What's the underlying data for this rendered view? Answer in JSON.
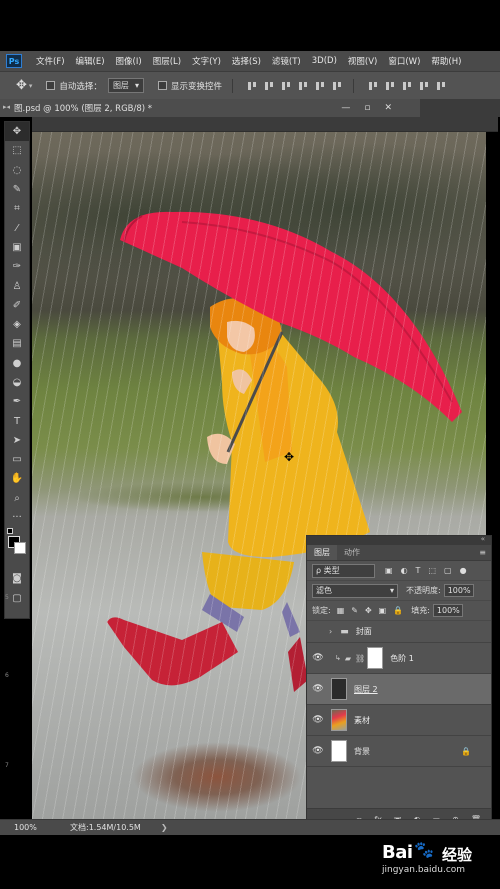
{
  "app": {
    "logo_text": "Ps"
  },
  "menu": [
    "文件(F)",
    "编辑(E)",
    "图像(I)",
    "图层(L)",
    "文字(Y)",
    "选择(S)",
    "滤镜(T)",
    "3D(D)",
    "视图(V)",
    "窗口(W)",
    "帮助(H)"
  ],
  "options_bar": {
    "auto_select_label": "自动选择：",
    "auto_select_value": "图层",
    "show_transform_label": "显示变换控件"
  },
  "document_tab": {
    "title": "图.psd @ 100% (图层 2, RGB/8) *"
  },
  "status_bar": {
    "zoom": "100%",
    "doc_info": "文档:1.54M/10.5M",
    "arrow": "❯"
  },
  "ruler_marks": [
    "5",
    "6",
    "7"
  ],
  "layers_panel": {
    "tabs": [
      "图层",
      "动作"
    ],
    "filter_label": "ρ 类型",
    "blend_mode": "滤色",
    "opacity_label": "不透明度:",
    "opacity_value": "100%",
    "lock_label": "锁定:",
    "fill_label": "填充:",
    "fill_value": "100%",
    "layers": [
      {
        "name": "封面",
        "type": "group",
        "visible": false
      },
      {
        "name": "色阶 1",
        "type": "adjustment",
        "visible": true
      },
      {
        "name": "图层 2",
        "type": "pixel",
        "visible": true,
        "selected": true
      },
      {
        "name": "素材",
        "type": "photo",
        "visible": true
      },
      {
        "name": "背景",
        "type": "background",
        "visible": true,
        "locked": true
      }
    ],
    "footer_icons": [
      "∞",
      "fx",
      "▣",
      "◐",
      "▭",
      "⊕",
      "🗑"
    ]
  },
  "watermark": {
    "logo": "Bai",
    "product": "经验",
    "url": "jingyan.baidu.com"
  }
}
